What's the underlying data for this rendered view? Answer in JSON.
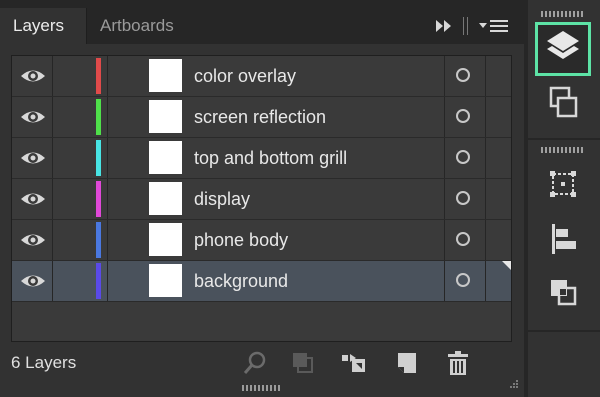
{
  "tabs": {
    "layers": "Layers",
    "artboards": "Artboards"
  },
  "layers": [
    {
      "name": "color overlay",
      "color": "#e04a4a",
      "selected": false
    },
    {
      "name": "screen reflection",
      "color": "#4fe04a",
      "selected": false
    },
    {
      "name": "top and bottom grill",
      "color": "#48e4e4",
      "selected": false
    },
    {
      "name": "display",
      "color": "#e048d8",
      "selected": false
    },
    {
      "name": "phone body",
      "color": "#4a78e0",
      "selected": false
    },
    {
      "name": "background",
      "color": "#5a4ae8",
      "selected": true
    }
  ],
  "footer": {
    "count_label": "6 Layers"
  },
  "icons": {
    "visibility": "eye-icon",
    "target": "target-circle-icon",
    "locate": "search-icon",
    "clipping_mask": "clipping-mask-icon",
    "sublayer": "new-sublayer-icon",
    "new_layer": "new-layer-icon",
    "delete": "trash-icon",
    "rail": [
      "layers-icon",
      "artboards-icon",
      "transform-icon",
      "align-icon",
      "pathfinder-icon"
    ]
  },
  "colors": {
    "rail_active_border": "#5de3a6",
    "selection": "#4a525c"
  }
}
